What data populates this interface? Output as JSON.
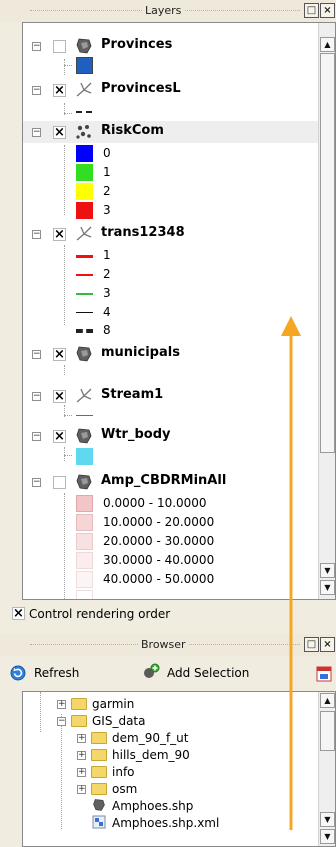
{
  "layers_panel": {
    "title": "Layers",
    "layers": [
      {
        "name": "Provinces",
        "checked": false,
        "icon": "polygon-layer-icon"
      },
      {
        "name": "ProvincesL",
        "checked": true,
        "icon": "line-layer-icon"
      },
      {
        "name": "RiskCom",
        "checked": true,
        "icon": "point-layer-icon"
      },
      {
        "name": "trans12348",
        "checked": true,
        "icon": "line-layer-icon"
      },
      {
        "name": "municipals",
        "checked": true,
        "icon": "polygon-layer-icon"
      },
      {
        "name": "Stream1",
        "checked": true,
        "icon": "line-layer-icon"
      },
      {
        "name": "Wtr_body",
        "checked": true,
        "icon": "polygon-layer-icon"
      },
      {
        "name": "Amp_CBDRMinAll",
        "checked": false,
        "icon": "polygon-layer-icon"
      }
    ],
    "riskcom_legend": [
      {
        "label": "0",
        "color": "#0000ff"
      },
      {
        "label": "1",
        "color": "#33dd22"
      },
      {
        "label": "2",
        "color": "#ffff00"
      },
      {
        "label": "3",
        "color": "#ee1111"
      }
    ],
    "trans_legend": [
      "1",
      "2",
      "3",
      "4",
      "8"
    ],
    "amp_legend": [
      {
        "label": "0.0000 - 10.0000",
        "color": "#f2c6c8"
      },
      {
        "label": "10.0000 - 20.0000",
        "color": "#f6d5d6"
      },
      {
        "label": "20.0000 - 30.0000",
        "color": "#f8e1e1"
      },
      {
        "label": "30.0000 - 40.0000",
        "color": "#fbeced"
      },
      {
        "label": "40.0000 - 50.0000",
        "color": "#fdf5f5"
      }
    ],
    "control_rendering_order": "Control rendering order"
  },
  "browser_panel": {
    "title": "Browser",
    "refresh_label": "Refresh",
    "add_selection_label": "Add Selection",
    "items": [
      {
        "name": "garmin",
        "type": "folder"
      },
      {
        "name": "GIS_data",
        "type": "folder"
      },
      {
        "name": "dem_90_f_ut",
        "type": "folder"
      },
      {
        "name": "hills_dem_90",
        "type": "folder"
      },
      {
        "name": "info",
        "type": "folder"
      },
      {
        "name": "osm",
        "type": "folder"
      },
      {
        "name": "Amphoes.shp",
        "type": "shapefile"
      },
      {
        "name": "Amphoes.shp.xml",
        "type": "xml"
      }
    ]
  },
  "colors": {
    "province_swatch": "#1f5fbf",
    "arrow": "#f5a623",
    "stream_line": "#3a6fd8",
    "wtr_swatch": "#5fd8f0"
  }
}
